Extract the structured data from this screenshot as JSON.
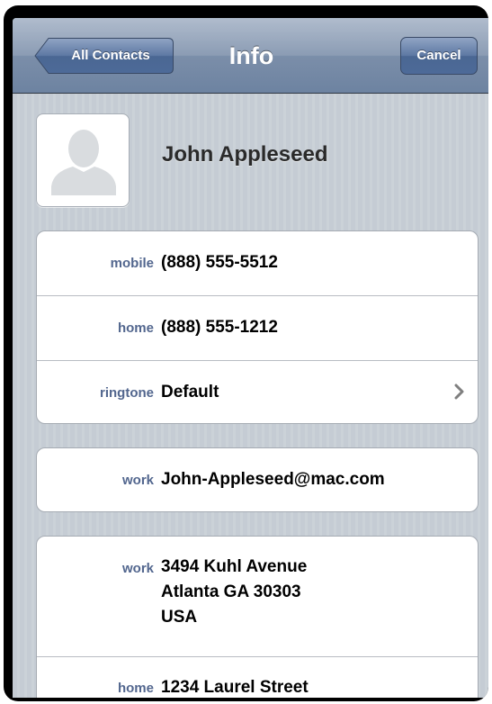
{
  "nav": {
    "back_label": "All Contacts",
    "title": "Info",
    "cancel_label": "Cancel"
  },
  "contact": {
    "name": "John Appleseed",
    "avatar_icon": "person-silhouette-icon"
  },
  "phone_group": [
    {
      "label": "mobile",
      "value": "(888) 555-5512"
    },
    {
      "label": "home",
      "value": "(888) 555-1212"
    },
    {
      "label": "ringtone",
      "value": "Default",
      "icon": "chevron-right-icon"
    }
  ],
  "email_group": [
    {
      "label": "work",
      "value": "John-Appleseed@mac.com"
    }
  ],
  "address_group": [
    {
      "label": "work",
      "lines": [
        "3494 Kuhl Avenue",
        "Atlanta GA 30303",
        "USA"
      ]
    },
    {
      "label": "home",
      "lines": [
        "1234 Laurel Street"
      ]
    }
  ],
  "colors": {
    "label_blue": "#52668e",
    "nav_bar": "#7b8ea9",
    "background_stripe": "#c5ccd4"
  }
}
